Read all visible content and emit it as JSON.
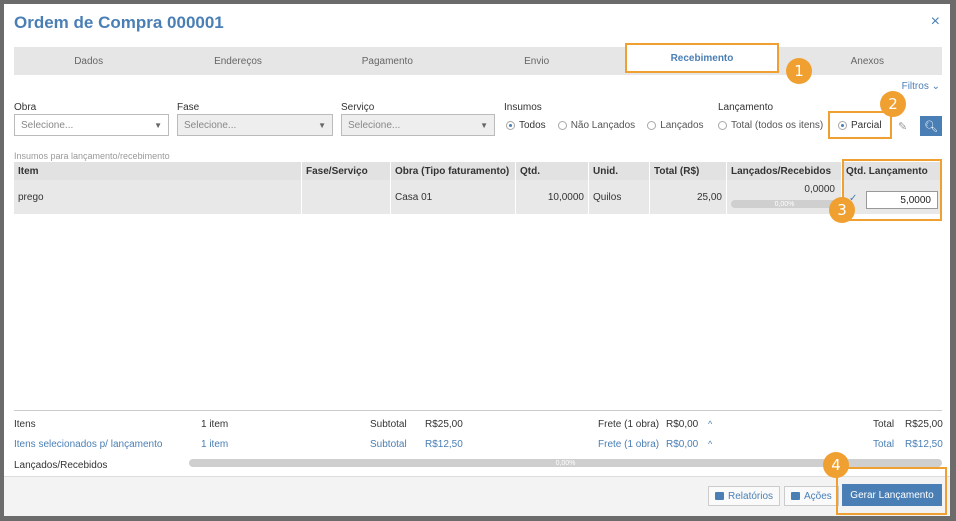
{
  "modal": {
    "title": "Ordem de Compra 000001",
    "close_icon": "×"
  },
  "tabs": [
    {
      "label": "Dados"
    },
    {
      "label": "Endereços"
    },
    {
      "label": "Pagamento"
    },
    {
      "label": "Envio"
    },
    {
      "label": "Recebimento",
      "active": true
    },
    {
      "label": "Anexos"
    }
  ],
  "filters": {
    "toggle_label": "Filtros",
    "obra": {
      "label": "Obra",
      "value": "Selecione..."
    },
    "fase": {
      "label": "Fase",
      "value": "Selecione..."
    },
    "servico": {
      "label": "Serviço",
      "value": "Selecione..."
    },
    "insumos": {
      "label": "Insumos",
      "options": [
        "Todos",
        "Não Lançados",
        "Lançados"
      ],
      "selected": "Todos"
    },
    "lancamento": {
      "label": "Lançamento",
      "options": [
        "Total (todos os itens)",
        "Parcial"
      ],
      "selected": "Parcial"
    }
  },
  "section": {
    "title": "Insumos para lançamento/recebimento"
  },
  "table": {
    "headers": [
      "Item",
      "Fase/Serviço",
      "Obra (Tipo faturamento)",
      "Qtd.",
      "Unid.",
      "Total (R$)",
      "Lançados/Recebidos",
      "Qtd. Lançamento"
    ],
    "rows": [
      {
        "item": "prego",
        "fase": "",
        "obra": "Casa 01",
        "qtd": "10,0000",
        "unid": "Quilos",
        "total": "25,00",
        "lancados": "0,0000",
        "lancados_pct": "0,00%",
        "lancados_fraction": 0,
        "qtd_lancamento": "5,0000"
      }
    ]
  },
  "footer": {
    "itens": {
      "label": "Itens",
      "count": "1 item",
      "subtotal_label": "Subtotal",
      "subtotal": "R$25,00",
      "frete_label": "Frete (1 obra)",
      "frete": "R$0,00",
      "total_label": "Total",
      "total": "R$25,00"
    },
    "selecionados": {
      "label": "Itens selecionados p/ lançamento",
      "count": "1 item",
      "subtotal_label": "Subtotal",
      "subtotal": "R$12,50",
      "frete_label": "Frete (1 obra)",
      "frete": "R$0,00",
      "total_label": "Total",
      "total": "R$12,50"
    },
    "lancados": {
      "label": "Lançados/Recebidos",
      "pct": "0,00%",
      "fraction": 0
    }
  },
  "actions": {
    "relatorios": "Relatórios",
    "acoes": "Ações",
    "gerar": "Gerar Lançamento"
  },
  "badges": [
    "1",
    "2",
    "3",
    "4"
  ],
  "colors": {
    "accent": "#4a7fb5",
    "highlight": "#f0a030"
  },
  "icons": {
    "filtros": "chevron-down-icon",
    "search": "search-icon",
    "clear": "eraser-icon",
    "check": "check-icon",
    "expand": "chevron-up-icon"
  }
}
